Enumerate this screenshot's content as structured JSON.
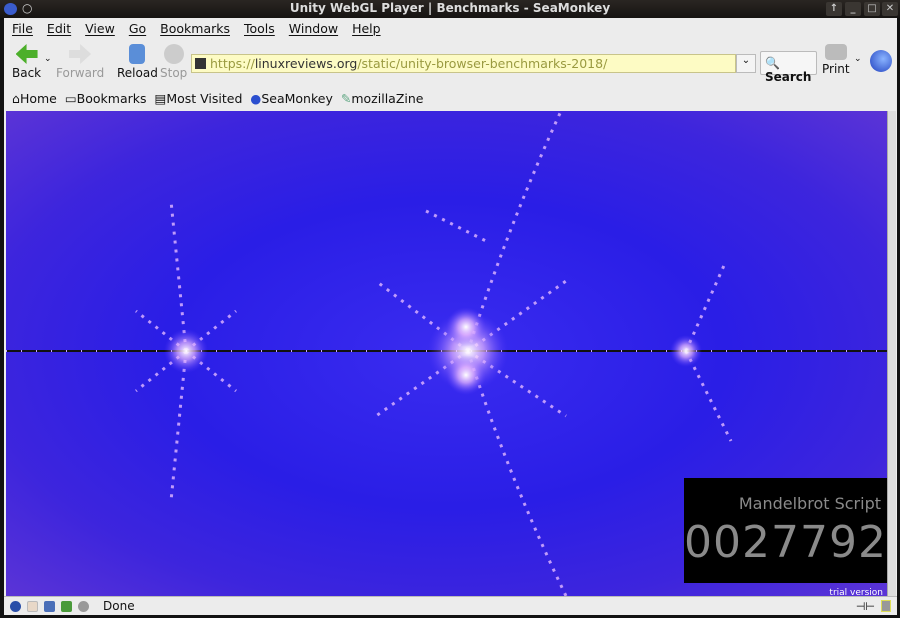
{
  "window": {
    "title": "Unity WebGL Player | Benchmarks - SeaMonkey"
  },
  "menu": [
    "File",
    "Edit",
    "View",
    "Go",
    "Bookmarks",
    "Tools",
    "Window",
    "Help"
  ],
  "nav": {
    "back": "Back",
    "forward": "Forward",
    "reload": "Reload",
    "stop": "Stop",
    "print": "Print",
    "search": "Search",
    "url_scheme": "https://",
    "url_host": "linuxreviews.org",
    "url_path": "/static/unity-browser-benchmarks-2018/"
  },
  "bookmarks": [
    "Home",
    "Bookmarks",
    "Most Visited",
    "SeaMonkey",
    "mozillaZine"
  ],
  "benchmark": {
    "label": "Mandelbrot Script",
    "score": "0027792",
    "trial": "trial version"
  },
  "status": {
    "text": "Done"
  }
}
